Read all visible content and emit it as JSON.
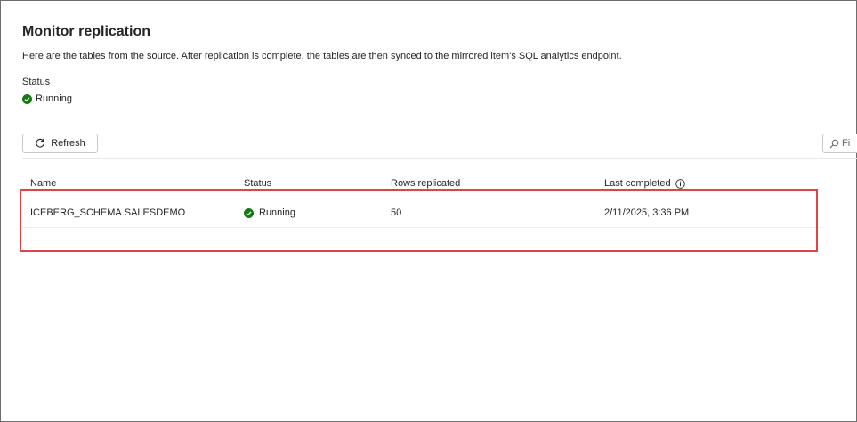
{
  "page": {
    "title": "Monitor replication",
    "description": "Here are the tables from the source. After replication is complete, the tables are then synced to the mirrored item's SQL analytics endpoint.",
    "status_label": "Status",
    "status_value": "Running",
    "status_color": "#107c10"
  },
  "toolbar": {
    "refresh_label": "Refresh",
    "refresh_icon": "refresh-icon",
    "filter_placeholder": "Fi",
    "filter_icon": "search-icon"
  },
  "table": {
    "columns": [
      "Name",
      "Status",
      "Rows replicated",
      "Last completed"
    ],
    "rows": [
      {
        "name": "ICEBERG_SCHEMA.SALESDEMO",
        "status": "Running",
        "rows_replicated": "50",
        "last_completed": "2/11/2025, 3:36 PM"
      }
    ]
  },
  "highlight_color": "#e04343"
}
